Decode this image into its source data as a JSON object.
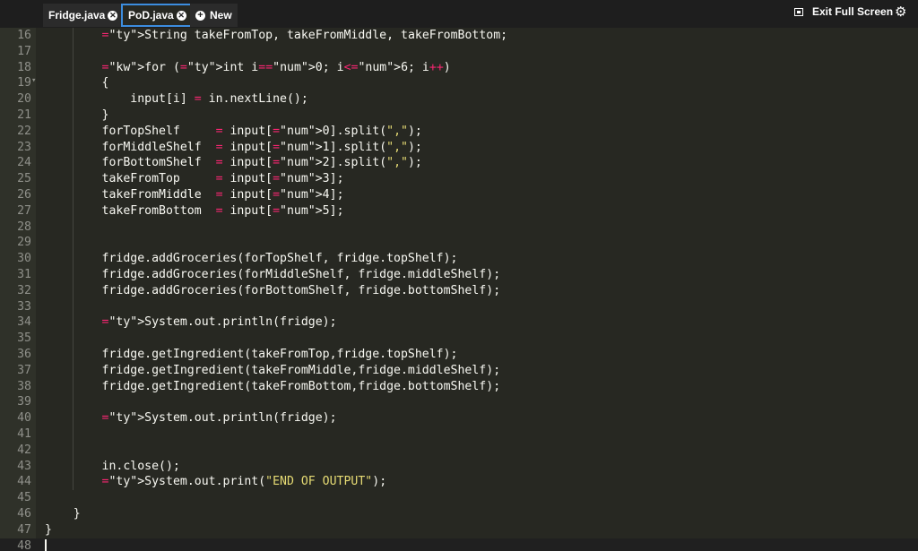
{
  "tabs": [
    {
      "label": "Fridge.java",
      "active": false
    },
    {
      "label": "PoD.java",
      "active": true
    }
  ],
  "new_tab_label": "New",
  "exit_fullscreen_label": "Exit Full Screen",
  "editor": {
    "lines": [
      {
        "n": "16",
        "text": "        String takeFromTop, takeFromMiddle, takeFromBottom;"
      },
      {
        "n": "17",
        "text": ""
      },
      {
        "n": "18",
        "text": "        for (int i=0; i<6; i++)"
      },
      {
        "n": "19",
        "text": "        {",
        "fold": true
      },
      {
        "n": "20",
        "text": "            input[i] = in.nextLine();"
      },
      {
        "n": "21",
        "text": "        }"
      },
      {
        "n": "22",
        "text": "        forTopShelf     = input[0].split(\",\");"
      },
      {
        "n": "23",
        "text": "        forMiddleShelf  = input[1].split(\",\");"
      },
      {
        "n": "24",
        "text": "        forBottomShelf  = input[2].split(\",\");"
      },
      {
        "n": "25",
        "text": "        takeFromTop     = input[3];"
      },
      {
        "n": "26",
        "text": "        takeFromMiddle  = input[4];"
      },
      {
        "n": "27",
        "text": "        takeFromBottom  = input[5];"
      },
      {
        "n": "28",
        "text": ""
      },
      {
        "n": "29",
        "text": ""
      },
      {
        "n": "30",
        "text": "        fridge.addGroceries(forTopShelf, fridge.topShelf);"
      },
      {
        "n": "31",
        "text": "        fridge.addGroceries(forMiddleShelf, fridge.middleShelf);"
      },
      {
        "n": "32",
        "text": "        fridge.addGroceries(forBottomShelf, fridge.bottomShelf);"
      },
      {
        "n": "33",
        "text": ""
      },
      {
        "n": "34",
        "text": "        System.out.println(fridge);"
      },
      {
        "n": "35",
        "text": ""
      },
      {
        "n": "36",
        "text": "        fridge.getIngredient(takeFromTop,fridge.topShelf);"
      },
      {
        "n": "37",
        "text": "        fridge.getIngredient(takeFromMiddle,fridge.middleShelf);"
      },
      {
        "n": "38",
        "text": "        fridge.getIngredient(takeFromBottom,fridge.bottomShelf);"
      },
      {
        "n": "39",
        "text": ""
      },
      {
        "n": "40",
        "text": "        System.out.println(fridge);"
      },
      {
        "n": "41",
        "text": ""
      },
      {
        "n": "42",
        "text": ""
      },
      {
        "n": "43",
        "text": "        in.close();"
      },
      {
        "n": "44",
        "text": "        System.out.print(\"END OF OUTPUT\");"
      },
      {
        "n": "45",
        "text": ""
      },
      {
        "n": "46",
        "text": "    }"
      },
      {
        "n": "47",
        "text": "}"
      },
      {
        "n": "48",
        "text": "",
        "active": true
      }
    ]
  },
  "colors": {
    "background": "#272822",
    "gutter": "#2f3129",
    "tabbar": "#1e1e1e",
    "active_tab_border": "#3c8dde",
    "keyword": "#f92672",
    "type": "#66d9ef",
    "number": "#ae81ff",
    "string": "#e6db74",
    "text": "#f8f8f2",
    "line_number": "#8f908a"
  },
  "icons": {
    "tab_close": "close-circle-icon",
    "new_tab": "plus-circle-icon",
    "exit_fullscreen": "exit-fullscreen-icon",
    "settings": "gear-icon"
  }
}
